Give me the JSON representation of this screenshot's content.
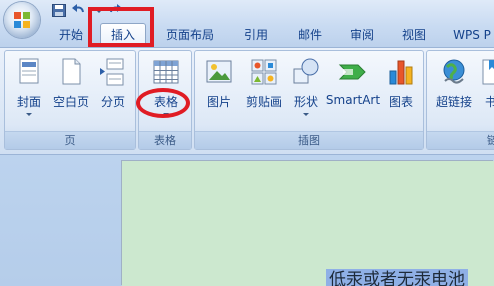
{
  "tabs": [
    {
      "label": "开始",
      "active": false
    },
    {
      "label": "插入",
      "active": true
    },
    {
      "label": "页面布局",
      "active": false
    },
    {
      "label": "引用",
      "active": false
    },
    {
      "label": "邮件",
      "active": false
    },
    {
      "label": "审阅",
      "active": false
    },
    {
      "label": "视图",
      "active": false
    },
    {
      "label": "WPS P",
      "active": false
    }
  ],
  "ribbon": {
    "groups": {
      "pages": {
        "label": "页",
        "buttons": {
          "cover": {
            "label": "封面",
            "icon": "cover-page-icon"
          },
          "blank": {
            "label": "空白页",
            "icon": "blank-page-icon"
          },
          "break": {
            "label": "分页",
            "icon": "page-break-icon"
          }
        }
      },
      "tables": {
        "label": "表格",
        "buttons": {
          "table": {
            "label": "表格",
            "icon": "table-grid-icon"
          }
        }
      },
      "illustrations": {
        "label": "插图",
        "buttons": {
          "picture": {
            "label": "图片",
            "icon": "picture-icon"
          },
          "clipart": {
            "label": "剪贴画",
            "icon": "clip-art-icon"
          },
          "shapes": {
            "label": "形状",
            "icon": "shapes-icon"
          },
          "smartart": {
            "label": "SmartArt",
            "icon": "smartart-icon"
          },
          "chart": {
            "label": "图表",
            "icon": "chart-icon"
          }
        }
      },
      "links": {
        "label": "链",
        "buttons": {
          "hyperlink": {
            "label": "超链接",
            "icon": "hyperlink-globe-icon"
          },
          "bookmark": {
            "label": "书",
            "icon": "bookmark-icon"
          }
        }
      }
    }
  },
  "document": {
    "visible_text": "低汞或者无汞电池"
  },
  "colors": {
    "annotation_red": "#e01c24",
    "ribbon_text": "#15428b",
    "page_background": "#cce8cf",
    "selection": "#8fb0e6"
  }
}
